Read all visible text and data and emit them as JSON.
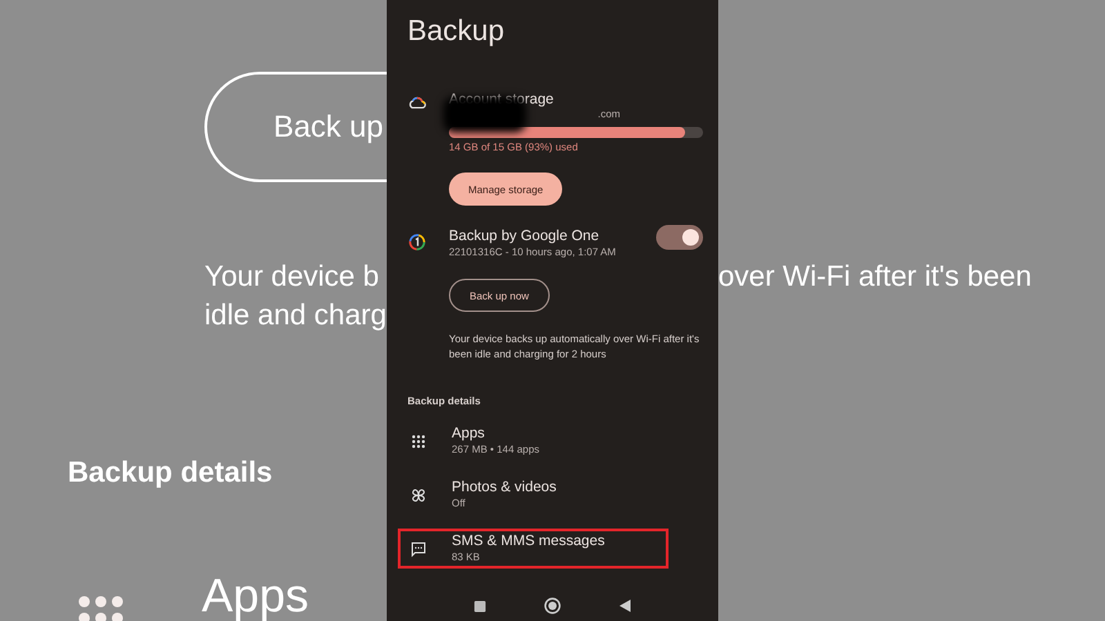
{
  "backdrop": {
    "left": {
      "button": "Back up",
      "description_lines": [
        "Your device b",
        "idle and charg"
      ],
      "section": "Backup details",
      "item": "Apps"
    },
    "right": {
      "description_lines": [
        "over Wi-Fi after it's been"
      ]
    }
  },
  "screen": {
    "title": "Backup",
    "storage": {
      "title": "Account storage",
      "email_visible": ".com",
      "level": 0.93,
      "usage": "14 GB of 15 GB (93%) used",
      "button": "Manage storage"
    },
    "backup": {
      "title": "Backup by Google One",
      "subtitle": "22101316C - 10 hours ago, 1:07 AM",
      "on": true,
      "button": "Back up now",
      "description": "Your device backs up automatically over Wi-Fi after it's been idle and charging for 2 hours"
    },
    "details_heading": "Backup details",
    "items": [
      {
        "kind": "apps",
        "title": "Apps",
        "subtitle": "267 MB • 144 apps",
        "highlighted": false
      },
      {
        "kind": "photos",
        "title": "Photos & videos",
        "subtitle": "Off",
        "highlighted": false
      },
      {
        "kind": "sms",
        "title": "SMS & MMS messages",
        "subtitle": "83 KB",
        "highlighted": true
      }
    ]
  }
}
